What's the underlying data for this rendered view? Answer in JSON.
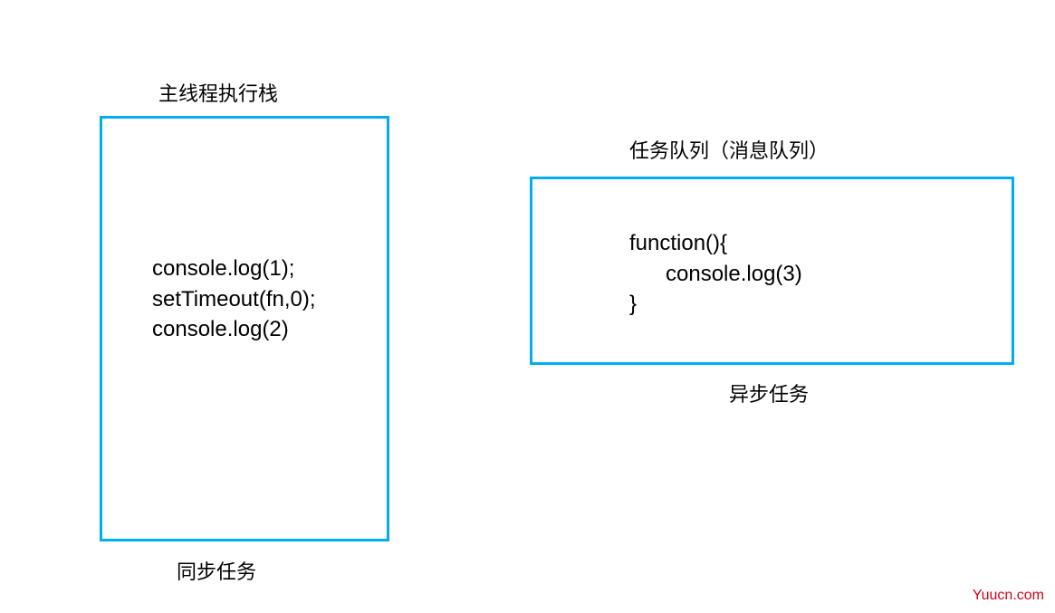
{
  "left": {
    "title": "主线程执行栈",
    "code": "console.log(1);\nsetTimeout(fn,0);\nconsole.log(2)",
    "caption": "同步任务"
  },
  "right": {
    "title": "任务队列（消息队列）",
    "code": "function(){\n      console.log(3)\n}",
    "caption": "异步任务"
  },
  "watermark": "Yuucn.com"
}
